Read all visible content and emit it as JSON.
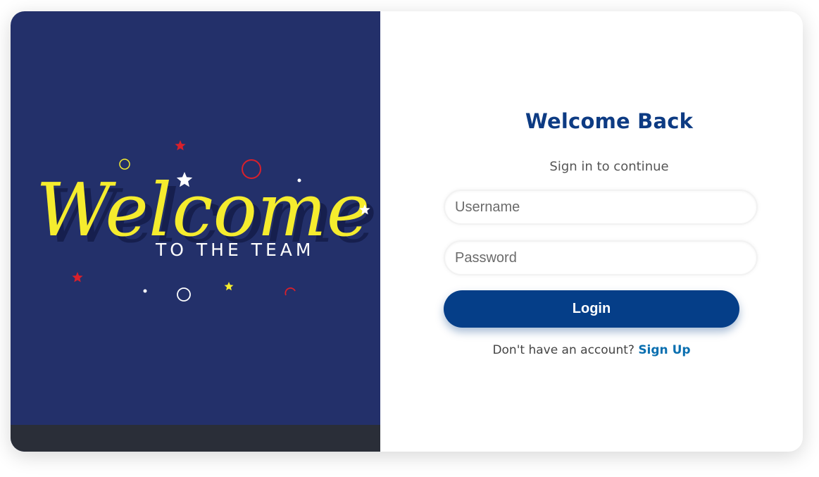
{
  "hero": {
    "headline": "Welcome",
    "tagline": "TO THE TEAM"
  },
  "login": {
    "title": "Welcome Back",
    "subtitle": "Sign in to continue",
    "username_placeholder": "Username",
    "password_placeholder": "Password",
    "login_label": "Login",
    "signup_prompt": "Don't have an account?",
    "signup_link": "Sign Up"
  },
  "colors": {
    "left_panel_bg": "#23306a",
    "headline_yellow": "#f5ec2e",
    "title_blue": "#0d3b83",
    "button_blue": "#053e88",
    "link_blue": "#0a6fb0",
    "star_red": "#d9202b"
  }
}
